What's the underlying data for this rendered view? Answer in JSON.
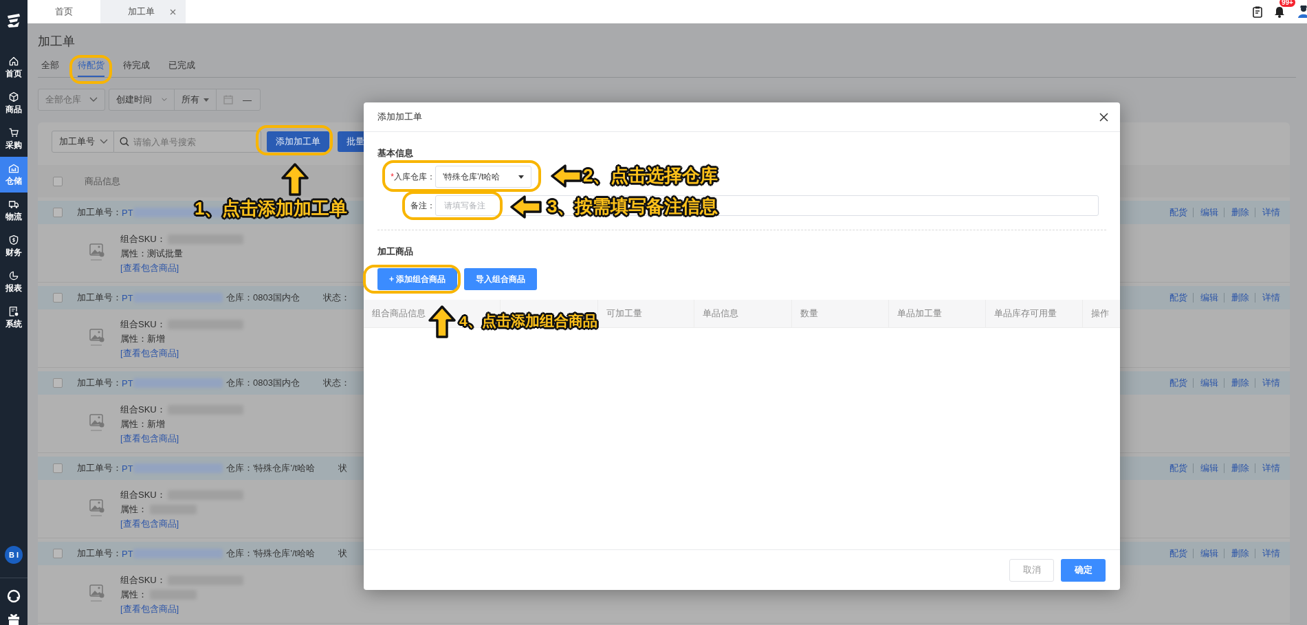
{
  "sidebar": {
    "items": [
      {
        "label": "首页",
        "selected": false
      },
      {
        "label": "商品",
        "selected": false
      },
      {
        "label": "采购",
        "selected": false
      },
      {
        "label": "仓储",
        "selected": true
      },
      {
        "label": "物流",
        "selected": false
      },
      {
        "label": "财务",
        "selected": false
      },
      {
        "label": "报表",
        "selected": false
      },
      {
        "label": "系统",
        "selected": false
      }
    ],
    "avatar": "B I"
  },
  "top_tabs": [
    {
      "label": "首页",
      "selected": false,
      "closable": false
    },
    {
      "label": "加工单",
      "selected": true,
      "closable": true
    }
  ],
  "notifications": {
    "badge": "99+"
  },
  "page": {
    "title": "加工单",
    "tabs": [
      {
        "label": "全部",
        "selected": false
      },
      {
        "label": "待配货",
        "selected": true
      },
      {
        "label": "待完成",
        "selected": false
      },
      {
        "label": "已完成",
        "selected": false
      }
    ],
    "filters": {
      "warehouse": "全部仓库",
      "time_field": "创建时间",
      "time_range": "所有",
      "date_separator": "—"
    }
  },
  "toolbar": {
    "search_type": "加工单号",
    "search_placeholder": "请输入单号搜索",
    "buttons": [
      "添加加工单",
      "批量"
    ]
  },
  "table": {
    "header_checked": false,
    "header": "商品信息",
    "orders": [
      {
        "checked": false,
        "order_label": "加工单号：",
        "order_no": "PT",
        "sku_label": "组合SKU：",
        "attr_label": "属性：",
        "attr_value": "测试批量",
        "link": "[查看包含商品]",
        "actions": [
          "配货",
          "编辑",
          "删除",
          "详情"
        ]
      },
      {
        "checked": false,
        "order_label": "加工单号：",
        "order_no": "PT",
        "warehouse": "仓库：0803国内仓",
        "status": "状态：",
        "sku_label": "组合SKU：",
        "attr_label": "属性：",
        "attr_value": "新增",
        "link": "[查看包含商品]",
        "actions": [
          "配货",
          "编辑",
          "删除",
          "详情"
        ]
      },
      {
        "checked": false,
        "order_label": "加工单号：",
        "order_no": "PT",
        "warehouse": "仓库：0803国内仓",
        "status": "状态：",
        "sku_label": "组合SKU：",
        "attr_label": "属性：",
        "attr_value": "新增",
        "link": "[查看包含商品]",
        "actions": [
          "配货",
          "编辑",
          "删除",
          "详情"
        ]
      },
      {
        "checked": false,
        "order_label": "加工单号：",
        "order_no": "PT",
        "warehouse": "仓库：'特殊仓库'/t哈哈",
        "status": "状",
        "sku_label": "组合SKU：",
        "attr_label": "属性：",
        "link": "[查看包含商品]",
        "actions": [
          "配货",
          "编辑",
          "删除",
          "详情"
        ]
      },
      {
        "checked": false,
        "order_label": "加工单号：",
        "order_no": "PT",
        "warehouse": "仓库：'特殊仓库'/t哈哈",
        "status": "状",
        "sku_label": "组合SKU：",
        "attr_label": "属性：",
        "link": "[查看包含商品]",
        "actions": [
          "配货",
          "编辑",
          "删除",
          "详情"
        ]
      }
    ]
  },
  "modal": {
    "title": "添加加工单",
    "section_basic": "基本信息",
    "warehouse_label": "入库仓库：",
    "required": true,
    "required_mark": "*",
    "warehouse_value": "'特殊仓库'/t哈哈",
    "remark_label": "备注：",
    "remark_placeholder": "请填写备注",
    "section_goods": "加工商品",
    "buttons": [
      "+ 添加组合商品",
      "导入组合商品"
    ],
    "columns": [
      "组合商品信息",
      "",
      "可加工量",
      "单品信息",
      "数量",
      "单品加工量",
      "单品库存可用量",
      "操作"
    ],
    "footer_buttons": [
      {
        "label": "取消",
        "kind": "secondary"
      },
      {
        "label": "确定",
        "kind": "primary"
      }
    ]
  },
  "annotations": [
    {
      "text": "1、点击添加加工单"
    },
    {
      "text": "2、点击选择仓库"
    },
    {
      "text": "3、按需填写备注信息"
    },
    {
      "text": "4、点击添加组合商品"
    }
  ]
}
